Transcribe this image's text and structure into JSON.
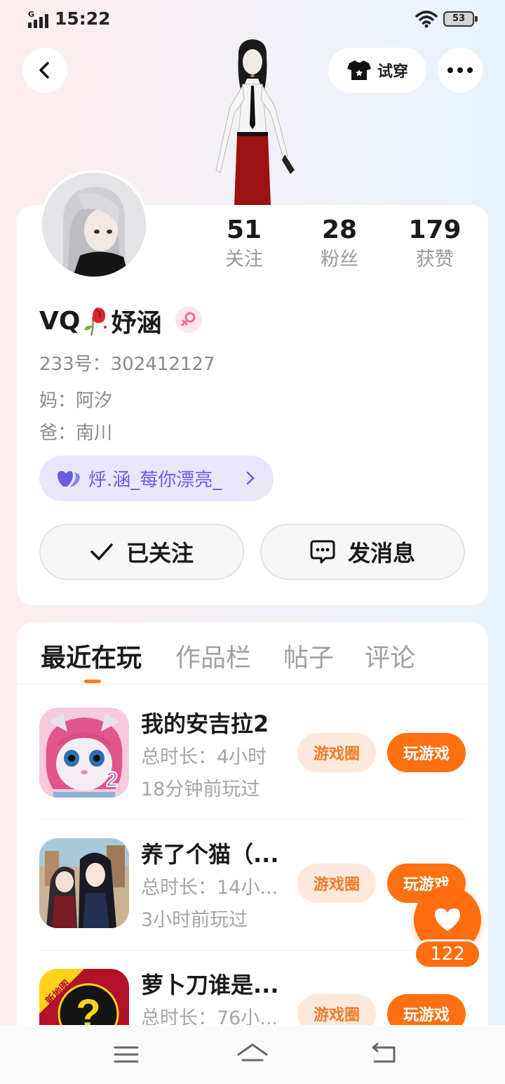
{
  "status_bar": {
    "time": "15:22",
    "network": "G",
    "battery": "53"
  },
  "header": {
    "tryon_label": "试穿"
  },
  "profile": {
    "username_prefix": "VQ",
    "username_suffix": "妤涵",
    "id_line": "233号：302412127",
    "mom_line": "妈：阿汐",
    "dad_line": "爸：南川",
    "family_label": "烀.涵_莓你漂亮_"
  },
  "stats": [
    {
      "value": "51",
      "label": "关注"
    },
    {
      "value": "28",
      "label": "粉丝"
    },
    {
      "value": "179",
      "label": "获赞"
    }
  ],
  "actions": {
    "follow_label": "已关注",
    "message_label": "发消息"
  },
  "tabs": [
    "最近在玩",
    "作品栏",
    "帖子",
    "评论"
  ],
  "games": [
    {
      "title": "我的安吉拉2",
      "duration": "总时长：4小时",
      "last_played": "18分钟前玩过",
      "circle_label": "游戏圈",
      "play_label": "玩游戏"
    },
    {
      "title": "养了个猫（...",
      "duration": "总时长：14小...",
      "last_played": "3小时前玩过",
      "circle_label": "游戏圈",
      "play_label": "玩游戏"
    },
    {
      "title": "萝卜刀谁是...",
      "duration": "总时长：76小...",
      "last_played": "",
      "circle_label": "游戏圈",
      "play_label": "玩游戏",
      "icon_badge": "新地图"
    }
  ],
  "like_fab": {
    "count": "122"
  },
  "colors": {
    "accent": "#ff7012",
    "family_chip": "#6b5ce7",
    "circle_bg": "#fde9dc"
  }
}
